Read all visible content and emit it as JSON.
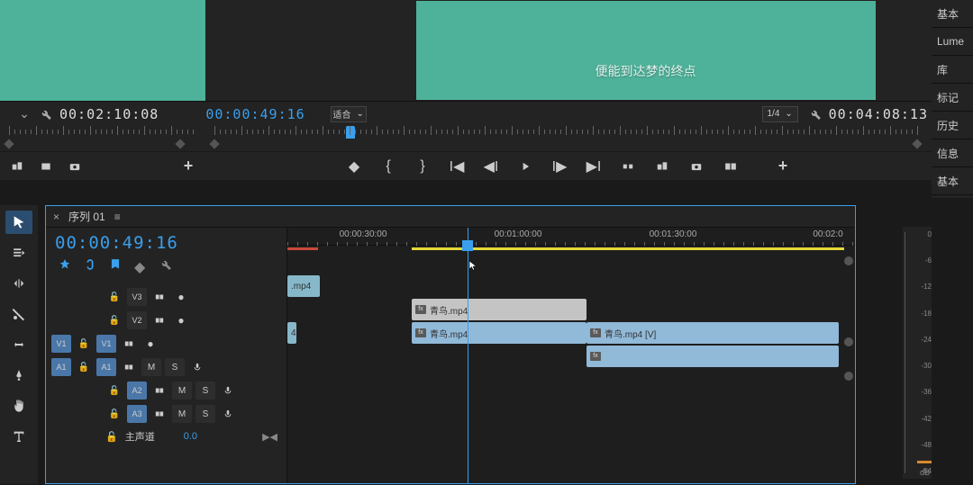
{
  "preview": {
    "caption": "便能到达梦的终点"
  },
  "rightTabs": {
    "t0": "基本",
    "t1": "Lume",
    "t2": "库",
    "t3": "标记",
    "t4": "历史",
    "t5": "信息",
    "t6": "基本"
  },
  "tcBar": {
    "left_tc": "00:02:10:08",
    "mid_tc": "00:00:49:16",
    "fit_label": "适合",
    "quarter_label": "1/4",
    "right_tc": "00:04:08:13"
  },
  "timeline": {
    "seq_name": "序列 01",
    "seq_tc": "00:00:49:16",
    "ruler": {
      "l0": "00:00:30:00",
      "l1": "00:01:00:00",
      "l2": "00:01:30:00",
      "l3": "00:02:0"
    },
    "tracks": {
      "v3": "V3",
      "v2": "V2",
      "v1": "V1",
      "v1src": "V1",
      "a1": "A1",
      "a1src": "A1",
      "a2": "A2",
      "a3": "A3",
      "m": "M",
      "s": "S"
    },
    "clips": {
      "c_v3": ".mp4",
      "c_v2": "青鸟.mp4",
      "c_v1a": "4",
      "c_v1b": "青鸟.mp4",
      "c_v1c": "青鸟.mp4 [V]"
    },
    "master": {
      "label": "主声道",
      "value": "0.0"
    }
  },
  "meter": {
    "db0": "0",
    "db6": "-6",
    "db12": "-12",
    "db18": "-18",
    "db24": "-24",
    "db30": "-30",
    "db36": "-36",
    "db42": "-42",
    "db48": "-48",
    "db54": "-54",
    "dblbl": "dB"
  }
}
